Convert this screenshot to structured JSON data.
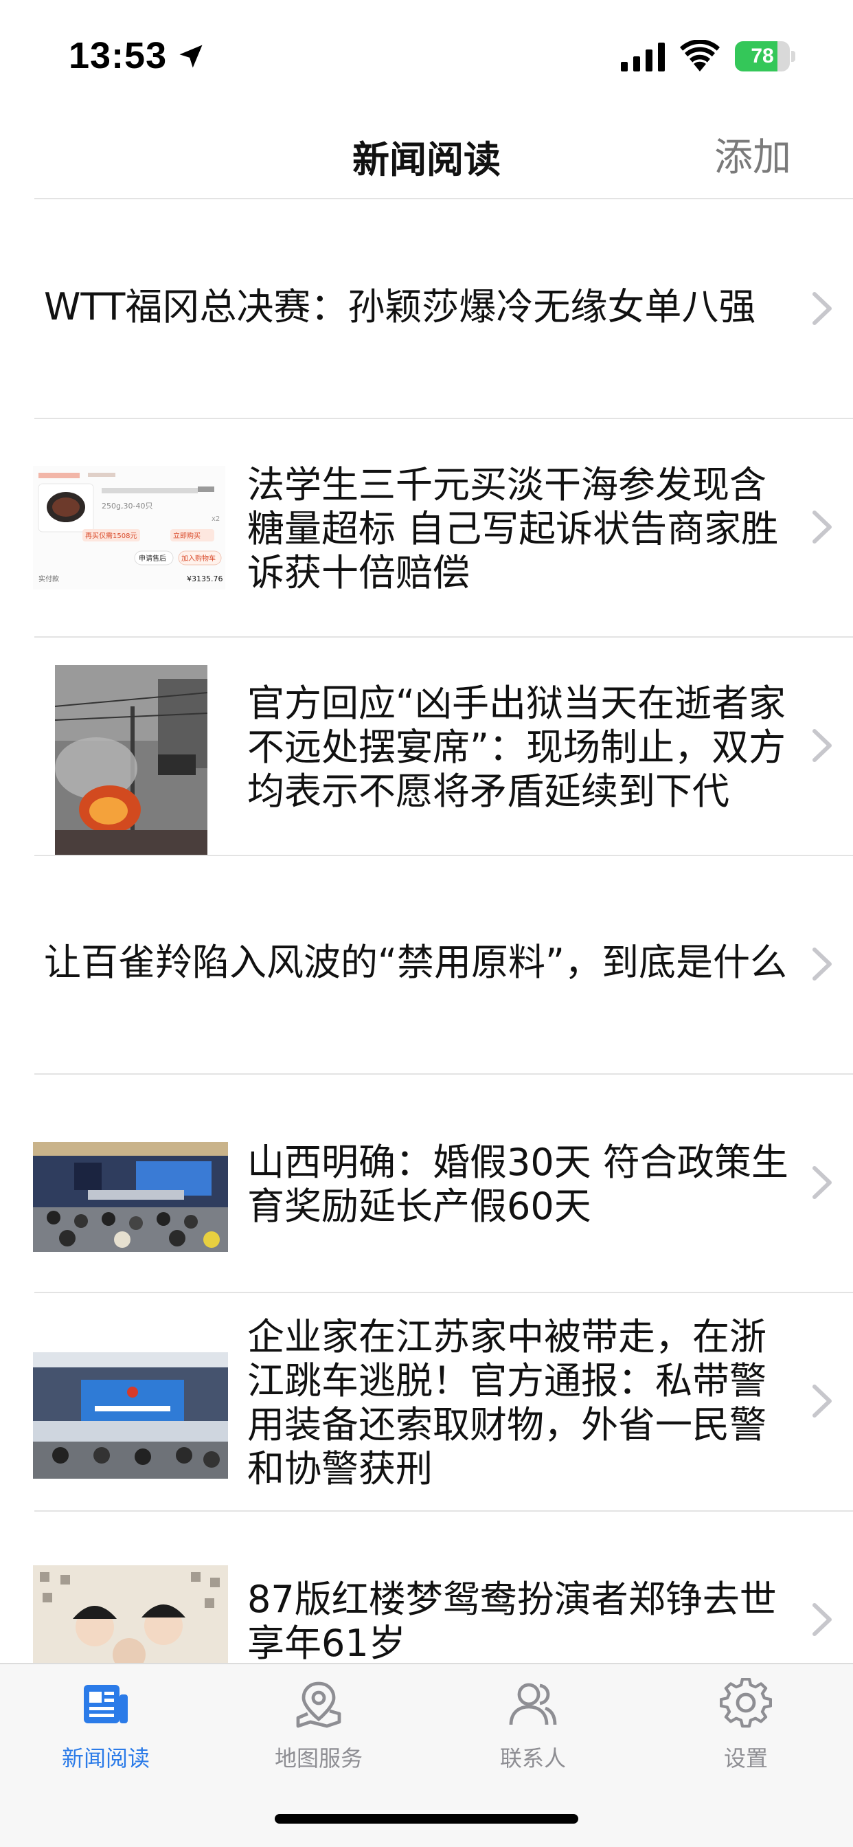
{
  "status_bar": {
    "time": "13:53",
    "battery_level": "78",
    "battery_fraction": 0.78,
    "battery_color": "#34c759"
  },
  "nav": {
    "title": "新闻阅读",
    "add_label": "添加"
  },
  "news": [
    {
      "title": "WTT福冈总决赛：孙颖莎爆冷无缘女单八强",
      "has_thumb": false
    },
    {
      "title": "法学生三千元买淡干海参发现含糖量超标 自己写起诉状告商家胜诉获十倍赔偿",
      "has_thumb": true,
      "thumb_icon": "receipt-screenshot-thumb",
      "thumb_text": {
        "price_info": "250g,30-40只",
        "repurchase": "再买仅需1508元",
        "buy_now": "立即购买",
        "after_sale": "申请售后",
        "add_cart": "加入购物车",
        "paid_label": "实付款",
        "paid_amount": "¥3135.76"
      }
    },
    {
      "title": "官方回应“凶手出狱当天在逝者家不远处摆宴席”：现场制止，双方均表示不愿将矛盾延续到下代",
      "has_thumb": true,
      "thumb_icon": "street-fire-photo-thumb"
    },
    {
      "title": "让百雀羚陷入风波的“禁用原料”，到底是什么",
      "has_thumb": false
    },
    {
      "title": "山西明确：婚假30天 符合政策生育奖励延长产假60天",
      "has_thumb": true,
      "thumb_icon": "press-conference-photo-thumb"
    },
    {
      "title": "企业家在江苏家中被带走，在浙江跳车逃脱！官方通报：私带警用装备还索取财物，外省一民警和协警获刑",
      "has_thumb": true,
      "thumb_icon": "press-conference-photo-thumb"
    },
    {
      "title": "87版红楼梦鸳鸯扮演者郑铮去世 享年61岁",
      "has_thumb": true,
      "thumb_icon": "opera-costume-photo-thumb"
    }
  ],
  "tabs": [
    {
      "label": "新闻阅读",
      "icon": "newspaper-icon",
      "active": true
    },
    {
      "label": "地图服务",
      "icon": "map-pin-icon",
      "active": false
    },
    {
      "label": "联系人",
      "icon": "contacts-icon",
      "active": false
    },
    {
      "label": "设置",
      "icon": "gear-icon",
      "active": false
    }
  ],
  "colors": {
    "accent": "#2b7be8",
    "tab_inactive": "#8e8e93",
    "divider": "#e3e3e3",
    "add_label": "#7a7a7a"
  }
}
